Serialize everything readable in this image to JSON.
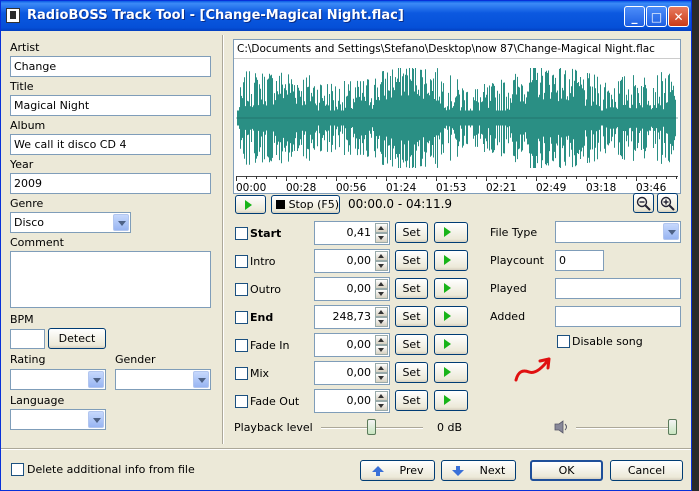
{
  "window": {
    "title": "RadioBOSS Track Tool - [Change-Magical Night.flac]",
    "minimize_glyph": "_",
    "maximize_glyph": "□",
    "close_glyph": "✕"
  },
  "left": {
    "artist_label": "Artist",
    "artist_value": "Change",
    "title_label": "Title",
    "title_value": "Magical Night",
    "album_label": "Album",
    "album_value": "We call it disco CD 4",
    "year_label": "Year",
    "year_value": "2009",
    "genre_label": "Genre",
    "genre_value": "Disco",
    "comment_label": "Comment",
    "comment_value": "",
    "bpm_label": "BPM",
    "bpm_value": "",
    "detect_label": "Detect",
    "rating_label": "Rating",
    "rating_value": "",
    "gender_label": "Gender",
    "gender_value": "",
    "language_label": "Language",
    "language_value": ""
  },
  "waveform": {
    "file_path": "C:\\Documents and Settings\\Stefano\\Desktop\\now 87\\Change-Magical Night.flac",
    "color": "#2a8f84",
    "time_ticks": [
      "00:00",
      "00:28",
      "00:56",
      "01:24",
      "01:53",
      "02:21",
      "02:49",
      "03:18",
      "03:46"
    ],
    "stop_label": "Stop (F5)",
    "position": "00:00.0 - 04:11.9",
    "zoom_out_icon": "zoom-out-icon",
    "zoom_in_icon": "zoom-in-icon"
  },
  "markers": [
    {
      "label": "Start",
      "value": "0,41",
      "bold": true
    },
    {
      "label": "Intro",
      "value": "0,00",
      "bold": false
    },
    {
      "label": "Outro",
      "value": "0,00",
      "bold": false
    },
    {
      "label": "End",
      "value": "248,73",
      "bold": true
    },
    {
      "label": "Fade In",
      "value": "0,00",
      "bold": false
    },
    {
      "label": "Mix",
      "value": "0,00",
      "bold": false
    },
    {
      "label": "Fade Out",
      "value": "0,00",
      "bold": false
    }
  ],
  "set_label": "Set",
  "playback": {
    "label": "Playback level",
    "value_text": "0 dB",
    "level": 0.5,
    "volume": 1.0,
    "speaker_icon": "speaker-icon"
  },
  "info": {
    "file_type_label": "File Type",
    "file_type_value": "",
    "playcount_label": "Playcount",
    "playcount_value": "0",
    "played_label": "Played",
    "played_value": "",
    "added_label": "Added",
    "added_value": "",
    "disable_song_label": "Disable song"
  },
  "annotation": {
    "color": "#e01010"
  },
  "footer": {
    "delete_info_label": "Delete additional info from file",
    "prev_label": "Prev",
    "next_label": "Next",
    "ok_label": "OK",
    "cancel_label": "Cancel"
  }
}
